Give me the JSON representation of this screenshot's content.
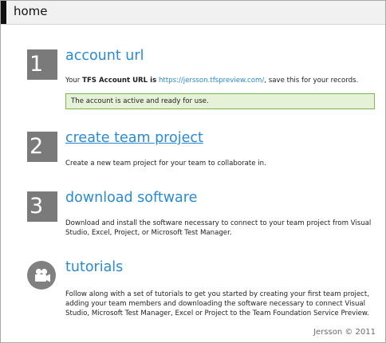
{
  "header": {
    "title": "home"
  },
  "steps": [
    {
      "number": "1",
      "title": "account url",
      "desc_prefix": "Your ",
      "desc_bold": "TFS Account URL is",
      "desc_link": "https://jersson.tfspreview.com/",
      "desc_suffix": ", save this for your records.",
      "status": "The account is active and ready for use."
    },
    {
      "number": "2",
      "title": "create team project",
      "desc": "Create a new team project for your team to collaborate in."
    },
    {
      "number": "3",
      "title": "download software",
      "desc_line1": "Download and install the software necessary to connect to your team project from Visual",
      "desc_line2": "Studio, Excel, Project, or Microsoft Test Manager."
    },
    {
      "icon": "video-camera-icon",
      "title": "tutorials",
      "desc_line1": "Follow along with a set of tutorials to get you started by creating your first team project,",
      "desc_line2": "adding your team members and downloading the software necessary to connect Visual",
      "desc_line3": "Studio, Microsoft Test Manager, Excel or Project to the Team Foundation Service Preview."
    }
  ],
  "footer": {
    "copyright": "Jersson © 2011"
  },
  "colors": {
    "accent_link": "#2a8ad4",
    "tile_gray": "#7a7a7a",
    "status_bg": "#e6f2d7",
    "status_border": "#7ab84a",
    "header_bg": "#f1f1f1"
  }
}
